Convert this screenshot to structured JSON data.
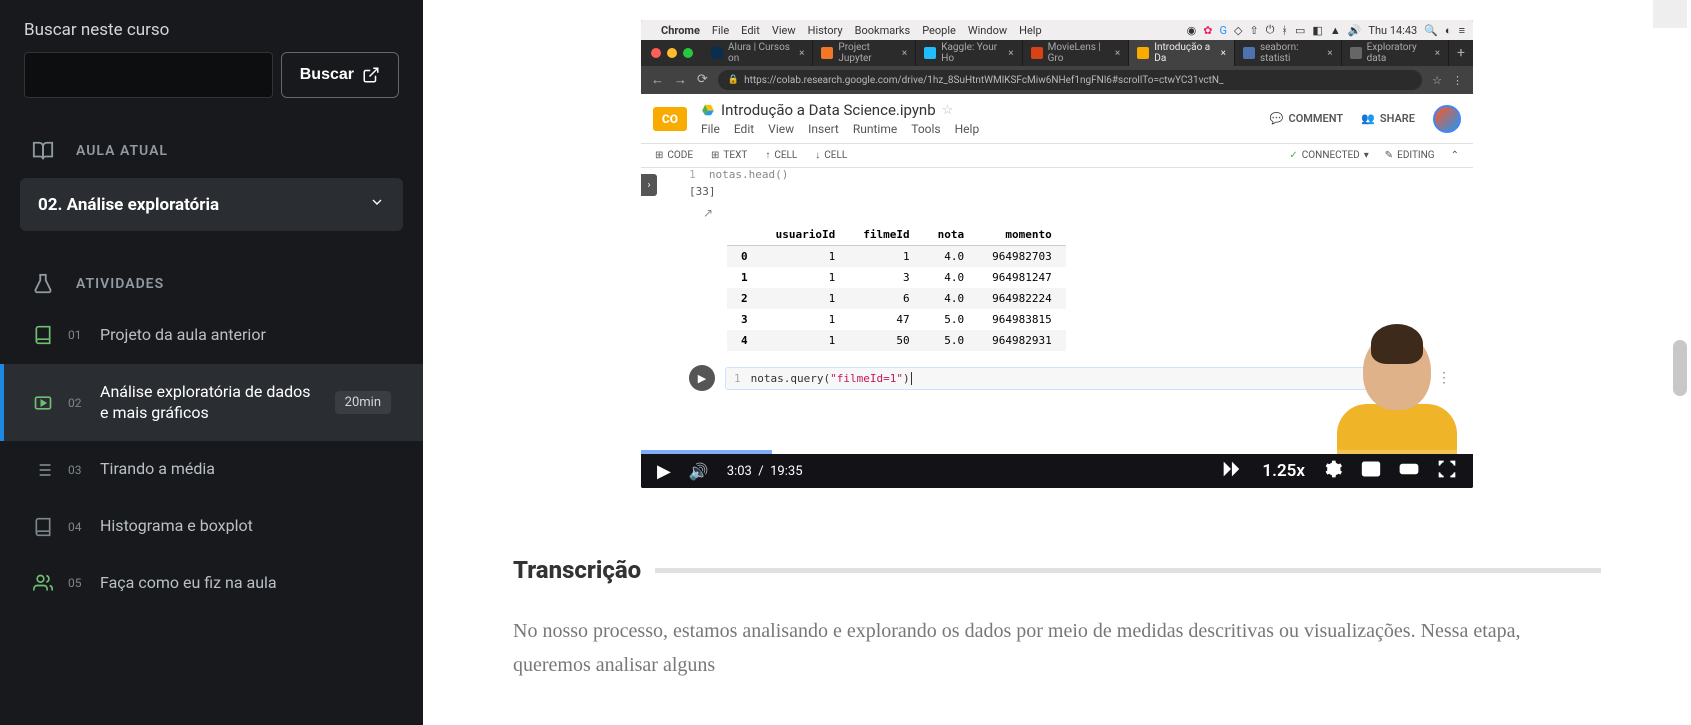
{
  "sidebar": {
    "search_label": "Buscar neste curso",
    "search_button": "Buscar",
    "section_current": "AULA ATUAL",
    "current_lesson": "02. Análise exploratória",
    "section_activities": "ATIVIDADES",
    "activities": [
      {
        "idx": "01",
        "title": "Projeto da aula anterior",
        "type": "book"
      },
      {
        "idx": "02",
        "title": "Análise exploratória de dados e mais gráficos",
        "type": "video",
        "active": true,
        "duration": "20min"
      },
      {
        "idx": "03",
        "title": "Tirando a média",
        "type": "list"
      },
      {
        "idx": "04",
        "title": "Histograma e boxplot",
        "type": "book"
      },
      {
        "idx": "05",
        "title": "Faça como eu fiz na aula",
        "type": "people"
      }
    ]
  },
  "video": {
    "mac": {
      "app": "Chrome",
      "menus": [
        "File",
        "Edit",
        "View",
        "History",
        "Bookmarks",
        "People",
        "Window",
        "Help"
      ],
      "clock": "Thu 14:43"
    },
    "tabs": [
      {
        "label": "Alura | Cursos on"
      },
      {
        "label": "Project Jupyter"
      },
      {
        "label": "Kaggle: Your Ho"
      },
      {
        "label": "MovieLens | Gro"
      },
      {
        "label": "Introdução a Da",
        "active": true
      },
      {
        "label": "seaborn: statisti"
      },
      {
        "label": "Exploratory data"
      }
    ],
    "url": "https://colab.research.google.com/drive/1hz_8SuHtntWMlKSFcMiw6NHef1ngFNl6#scrollTo=ctwYC31vctN_",
    "colab": {
      "title": "Introdução a Data Science.ipynb",
      "menus": [
        "File",
        "Edit",
        "View",
        "Insert",
        "Runtime",
        "Tools",
        "Help"
      ],
      "comment": "COMMENT",
      "share": "SHARE",
      "toolbar": {
        "code": "CODE",
        "text": "TEXT",
        "cell_up": "CELL",
        "cell_down": "CELL",
        "connected": "CONNECTED",
        "editing": "EDITING"
      }
    },
    "notebook": {
      "prev_line": "notas.head()",
      "out_label": "[33]",
      "columns": [
        "",
        "usuarioId",
        "filmeId",
        "nota",
        "momento"
      ],
      "rows": [
        [
          "0",
          "1",
          "1",
          "4.0",
          "964982703"
        ],
        [
          "1",
          "1",
          "3",
          "4.0",
          "964981247"
        ],
        [
          "2",
          "1",
          "6",
          "4.0",
          "964982224"
        ],
        [
          "3",
          "1",
          "47",
          "5.0",
          "964983815"
        ],
        [
          "4",
          "1",
          "50",
          "5.0",
          "964982931"
        ]
      ],
      "code_prefix": "notas.query(",
      "code_string": "\"filmeId=1\"",
      "code_suffix": ")"
    },
    "controls": {
      "current": "3:03",
      "sep": "/",
      "total": "19:35",
      "speed": "1.25x"
    }
  },
  "main": {
    "transcription_title": "Transcrição",
    "transcription_body": "No nosso processo, estamos analisando e explorando os dados por meio de medidas descritivas ou visualizações. Nessa etapa, queremos analisar alguns"
  }
}
